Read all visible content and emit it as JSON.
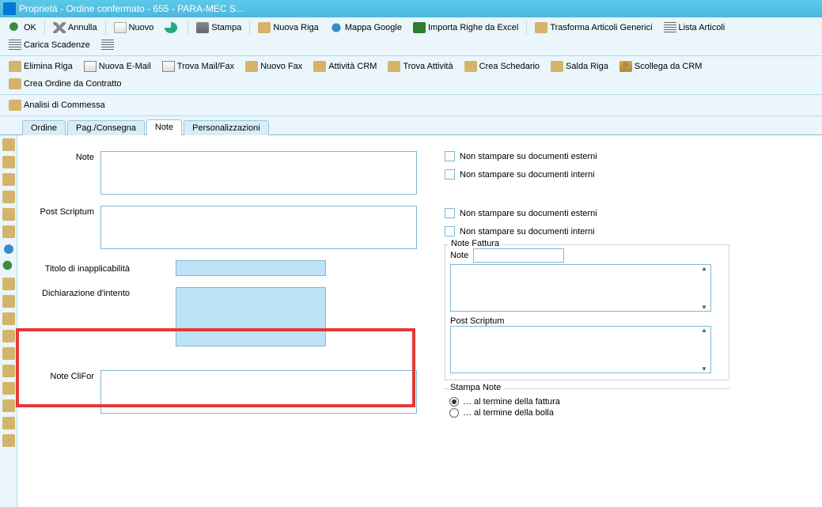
{
  "window": {
    "title": "Proprietà - Ordine confermato - 655 - PARA-MEC S..."
  },
  "toolbar1": {
    "ok": "OK",
    "annulla": "Annulla",
    "nuovo": "Nuovo",
    "stampa": "Stampa",
    "nuova_riga": "Nuova Riga",
    "mappa": "Mappa Google",
    "importa": "Importa Righe da Excel",
    "trasforma": "Trasforma Articoli Generici",
    "lista": "Lista Articoli",
    "carica": "Carica Scadenze"
  },
  "toolbar2": {
    "elimina": "Elimina Riga",
    "email": "Nuova E-Mail",
    "trova_mail": "Trova Mail/Fax",
    "nuovo_fax": "Nuovo Fax",
    "attivita": "Attività CRM",
    "trova_att": "Trova Attività",
    "schedario": "Crea Schedario",
    "salda": "Salda Riga",
    "scollega": "Scollega da CRM",
    "crea_ordine": "Crea Ordine da Contratto"
  },
  "toolbar3": {
    "analisi": "Analisi di Commessa"
  },
  "tabs": {
    "t1": "Ordine",
    "t2": "Pag./Consegna",
    "t3": "Note",
    "t4": "Personalizzazioni"
  },
  "labels": {
    "note": "Note",
    "ps": "Post Scriptum",
    "titolo": "Titolo di inapplicabilità",
    "dich": "Dichiarazione d'intento",
    "clifor": "Note CliFor"
  },
  "checks": {
    "c1": "Non stampare su documenti esterni",
    "c2": "Non stampare su documenti interni",
    "c3": "Non stampare su documenti esterni",
    "c4": "Non stampare su documenti interni"
  },
  "fieldsets": {
    "note_fattura": "Note Fattura",
    "nf_note": "Note",
    "nf_ps": "Post Scriptum",
    "stampa_note": "Stampa Note"
  },
  "radios": {
    "r1": "… al termine della fattura",
    "r2": "… al termine della bolla"
  }
}
